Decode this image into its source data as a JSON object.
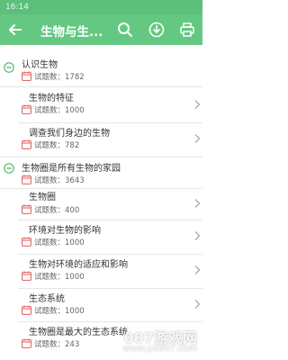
{
  "status_bar": {
    "time": "16:14"
  },
  "header": {
    "title": "生物与生..."
  },
  "count_prefix": "试题数：",
  "items": [
    {
      "name": "认识生物",
      "count_label": "试题数：1782"
    },
    {
      "name": "生物的特征",
      "count_label": "试题数：1000"
    },
    {
      "name": "调查我们身边的生物",
      "count_label": "试题数：782"
    },
    {
      "name": "生物圈是所有生物的家园",
      "count_label": "试题数：3643"
    },
    {
      "name": "生物圈",
      "count_label": "试题数：400"
    },
    {
      "name": "环境对生物的影响",
      "count_label": "试题数：1000"
    },
    {
      "name": "生物对环境的适应和影响",
      "count_label": "试题数：1000"
    },
    {
      "name": "生态系统",
      "count_label": "试题数：1000"
    },
    {
      "name": "生物圈是最大的生态系统",
      "count_label": "试题数：243"
    }
  ],
  "watermark": {
    "text": "007游戏网",
    "url": "www.yx007.com"
  }
}
